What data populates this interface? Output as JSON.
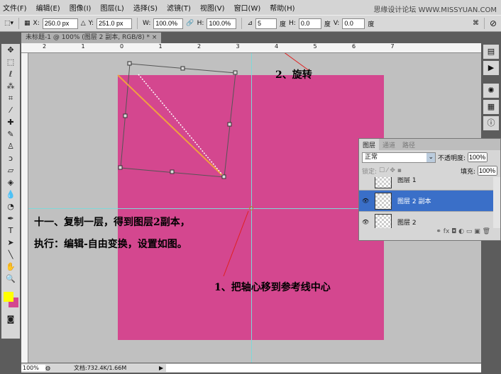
{
  "menu": [
    "文件(F)",
    "编辑(E)",
    "图像(I)",
    "图层(L)",
    "选择(S)",
    "滤镜(T)",
    "视图(V)",
    "窗口(W)",
    "帮助(H)"
  ],
  "watermark": "思缘设计论坛 WWW.MISSYUAN.COM",
  "options": {
    "x_label": "X:",
    "x": "250.0 px",
    "y_label": "Y:",
    "y": "251.0 px",
    "w_label": "W:",
    "w": "100.0%",
    "h_label": "H:",
    "h": "100.0%",
    "angle": "5",
    "deg": "度",
    "hskew_label": "H:",
    "hskew": "0.0",
    "vskew_label": "V:",
    "vskew": "0.0"
  },
  "doc_tab": "未标题-1 @ 100% (图层 2 副本, RGB/8) *",
  "doc_close": "×",
  "ruler_labels": [
    "2",
    "1",
    "0",
    "1",
    "2",
    "3",
    "4",
    "5",
    "6",
    "7"
  ],
  "tools": [
    "move-icon",
    "marquee-icon",
    "lasso-icon",
    "magic-wand-icon",
    "crop-icon",
    "eyedropper-icon",
    "healing-icon",
    "brush-icon",
    "stamp-icon",
    "history-brush-icon",
    "eraser-icon",
    "bucket-icon",
    "blur-icon",
    "dodge-icon",
    "pen-icon",
    "type-icon",
    "path-select-icon",
    "line-icon",
    "hand-icon",
    "zoom-icon"
  ],
  "colors": {
    "foreground": "#ffff00",
    "background": "#d4478f",
    "canvas": "#d4478f",
    "guide": "#7fd8d8",
    "selected": "#3a6fc8"
  },
  "annotations": {
    "rotate": "2、旋转",
    "step": "十一、复制一层，得到图层2副本，",
    "step2": "执行：编辑-自由变换，设置如图。",
    "pivot": "1、把轴心移到参考线中心"
  },
  "layers_panel": {
    "tabs": [
      "图层",
      "通道",
      "路径"
    ],
    "blend": "正常",
    "opacity_label": "不透明度:",
    "opacity": "100%",
    "lock_label": "锁定:",
    "fill_label": "填充:",
    "fill": "100%",
    "layers": [
      {
        "name": "图层 1",
        "visible": false,
        "selected": false
      },
      {
        "name": "图层 2 副本",
        "visible": true,
        "selected": true
      },
      {
        "name": "图层 2",
        "visible": true,
        "selected": false
      }
    ]
  },
  "status": {
    "zoom": "100%",
    "doc": "文档:732.4K/1.66M"
  }
}
